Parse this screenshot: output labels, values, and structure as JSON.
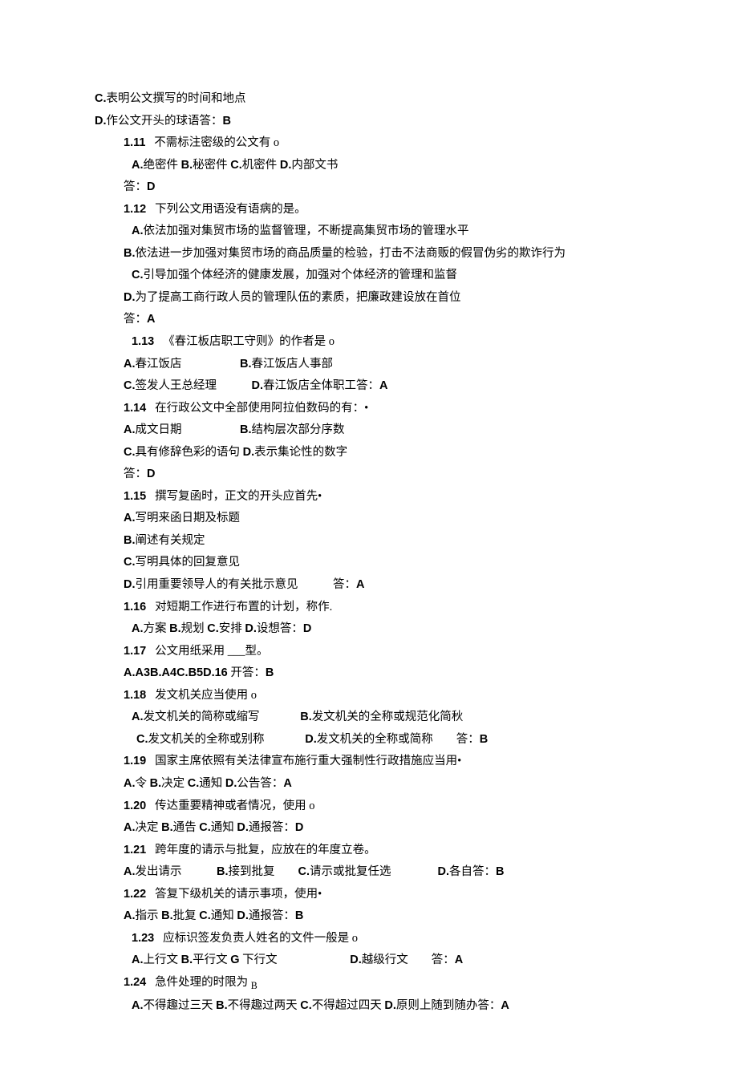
{
  "lines": [
    {
      "cls": "",
      "html": "<span class='bold'>C.</span>表明公文撰写的时间和地点"
    },
    {
      "cls": "",
      "html": "<span class='bold'>D.</span>作公文开头的球语答：<span class='bold'>B</span>"
    },
    {
      "cls": "indent1",
      "html": "<span class='bold'>1.11</span>   不需标注密级的公文有 o"
    },
    {
      "cls": "indent2",
      "html": "<span class='bold'>A.</span>绝密件 <span class='bold'>B.</span>秘密件 <span class='bold'>C.</span>机密件 <span class='bold'>D.</span>内部文书"
    },
    {
      "cls": "indent1",
      "html": "答：<span class='bold'>D</span>"
    },
    {
      "cls": "indent1",
      "html": "<span class='bold'>1.12</span>   下列公文用语没有语病的是。"
    },
    {
      "cls": "indent2",
      "html": "<span class='bold'>A.</span>依法加强对集贸市场的监督管理，不断提高集贸市场的管理水平"
    },
    {
      "cls": "indent1",
      "html": "<span class='bold'>B.</span>依法进一步加强对集贸市场的商品质量的检验，打击不法商贩的假冒伪劣的欺诈行为"
    },
    {
      "cls": "indent2",
      "html": "<span class='bold'>C.</span>引导加强个体经济的健康发展，加强对个体经济的管理和监督"
    },
    {
      "cls": "indent1",
      "html": "<span class='bold'>D.</span>为了提高工商行政人员的管理队伍的素质，把廉政建设放在首位"
    },
    {
      "cls": "indent1",
      "html": "答：<span class='bold'>A</span>"
    },
    {
      "cls": "indent2",
      "html": "<span class='bold'>1.13</span>   《春江板店职工守则》的作者是 o"
    },
    {
      "cls": "indent1",
      "html": "<span class='bold'>A.</span>春江饭店                    <span class='bold'>B.</span>春江饭店人事部"
    },
    {
      "cls": "indent1",
      "html": "<span class='bold'>C.</span>签发人王总经理            <span class='bold'>D.</span>春江饭店全体职工答：<span class='bold'>A</span>"
    },
    {
      "cls": "indent1",
      "html": "<span class='bold'>1.14</span>   在行政公文中全部使用阿拉伯数码的有：•"
    },
    {
      "cls": "indent1",
      "html": "<span class='bold'>A.</span>成文日期                    <span class='bold'>B.</span>结构层次部分序数"
    },
    {
      "cls": "indent1",
      "html": "<span class='bold'>C.</span>具有修辞色彩的语句 <span class='bold'>D.</span>表示集论性的数字"
    },
    {
      "cls": "indent1",
      "html": "答：<span class='bold'>D</span>"
    },
    {
      "cls": "indent1",
      "html": "<span class='bold'>1.15</span>   撰写复函时，正文的开头应首先•"
    },
    {
      "cls": "indent1",
      "html": "<span class='bold'>A.</span>写明来函日期及标题"
    },
    {
      "cls": "indent1",
      "html": "<span class='bold'>B.</span>阐述有关规定"
    },
    {
      "cls": "indent1",
      "html": "<span class='bold'>C.</span>写明具体的回复意见"
    },
    {
      "cls": "indent1",
      "html": "<span class='bold'>D.</span>引用重要领导人的有关批示意见            答：<span class='bold'>A</span>"
    },
    {
      "cls": "indent1",
      "html": "<span class='bold'>1.16</span>   对短期工作进行布置的计划，称作."
    },
    {
      "cls": "indent2",
      "html": "<span class='bold'>A.</span>方案 <span class='bold'>B.</span>规划 <span class='bold'>C.</span>安排 <span class='bold'>D.</span>设想答：<span class='bold'>D</span>"
    },
    {
      "cls": "indent1",
      "html": "<span class='bold'>1.17</span>   公文用纸采用 ___型。"
    },
    {
      "cls": "indent1",
      "html": "<span class='bold'>A.A3B.A4C.B5D.16</span> 开答：<span class='bold'>B</span>"
    },
    {
      "cls": "indent1",
      "html": "<span class='bold'>1.18</span>   发文机关应当使用 o"
    },
    {
      "cls": "indent2",
      "html": "<span class='bold'>A.</span>发文机关的简称或缩写              <span class='bold'>B.</span>发文机关的全称或规范化简秋"
    },
    {
      "cls": "indent3",
      "html": "<span class='bold'>C.</span>发文机关的全称或别称              <span class='bold'>D.</span>发文机关的全称或简称        答：<span class='bold'>B</span>"
    },
    {
      "cls": "indent1",
      "html": "<span class='bold'>1.19</span>   国家主席依照有关法律宣布施行重大强制性行政措施应当用•"
    },
    {
      "cls": "indent1",
      "html": "<span class='bold'>A.</span>令 <span class='bold'>B.</span>决定 <span class='bold'>C.</span>通知 <span class='bold'>D.</span>公告答：<span class='bold'>A</span>"
    },
    {
      "cls": "indent1",
      "html": "<span class='bold'>1.20</span>   传达重要精神或者情况，使用 o"
    },
    {
      "cls": "indent1",
      "html": "<span class='bold'>A.</span>决定 <span class='bold'>B.</span>通告 <span class='bold'>C.</span>通知 <span class='bold'>D.</span>通报答：<span class='bold'>D</span>"
    },
    {
      "cls": "indent1",
      "html": "<span class='bold'>1.21</span>   跨年度的请示与批复，应放在的年度立卷。"
    },
    {
      "cls": "indent1",
      "html": "<span class='bold'>A.</span>发出请示            <span class='bold'>B.</span>接到批复        <span class='bold'>C.</span>请示或批复任选                <span class='bold'>D.</span>各自答：<span class='bold'>B</span>"
    },
    {
      "cls": "indent1",
      "html": "<span class='bold'>1.22</span>   答复下级机关的请示事项，使用•"
    },
    {
      "cls": "indent1",
      "html": "<span class='bold'>A.</span>指示 <span class='bold'>B.</span>批复 <span class='bold'>C.</span>通知 <span class='bold'>D.</span>通报答：<span class='bold'>B</span>"
    },
    {
      "cls": "indent2",
      "html": "<span class='bold'>1.23</span>   应标识签发负责人姓名的文件一般是 o"
    },
    {
      "cls": "indent2",
      "html": "<span class='bold'>A.</span>上行文 <span class='bold'>B.</span>平行文 <span class='bold'>G</span> 下行文                         <span class='bold'>D.</span>越级行文        答：<span class='bold'>A</span>"
    },
    {
      "cls": "indent1",
      "html": "<span class='bold'>1.24</span>   急件处理的时限为 <sub>B</sub>"
    },
    {
      "cls": "indent2",
      "html": "<span class='bold'>A.</span>不得趣过三天 <span class='bold'>B.</span>不得趣过两天 <span class='bold'>C.</span>不得超过四天 <span class='bold'>D.</span>原则上随到随办答：<span class='bold'>A</span>"
    }
  ]
}
